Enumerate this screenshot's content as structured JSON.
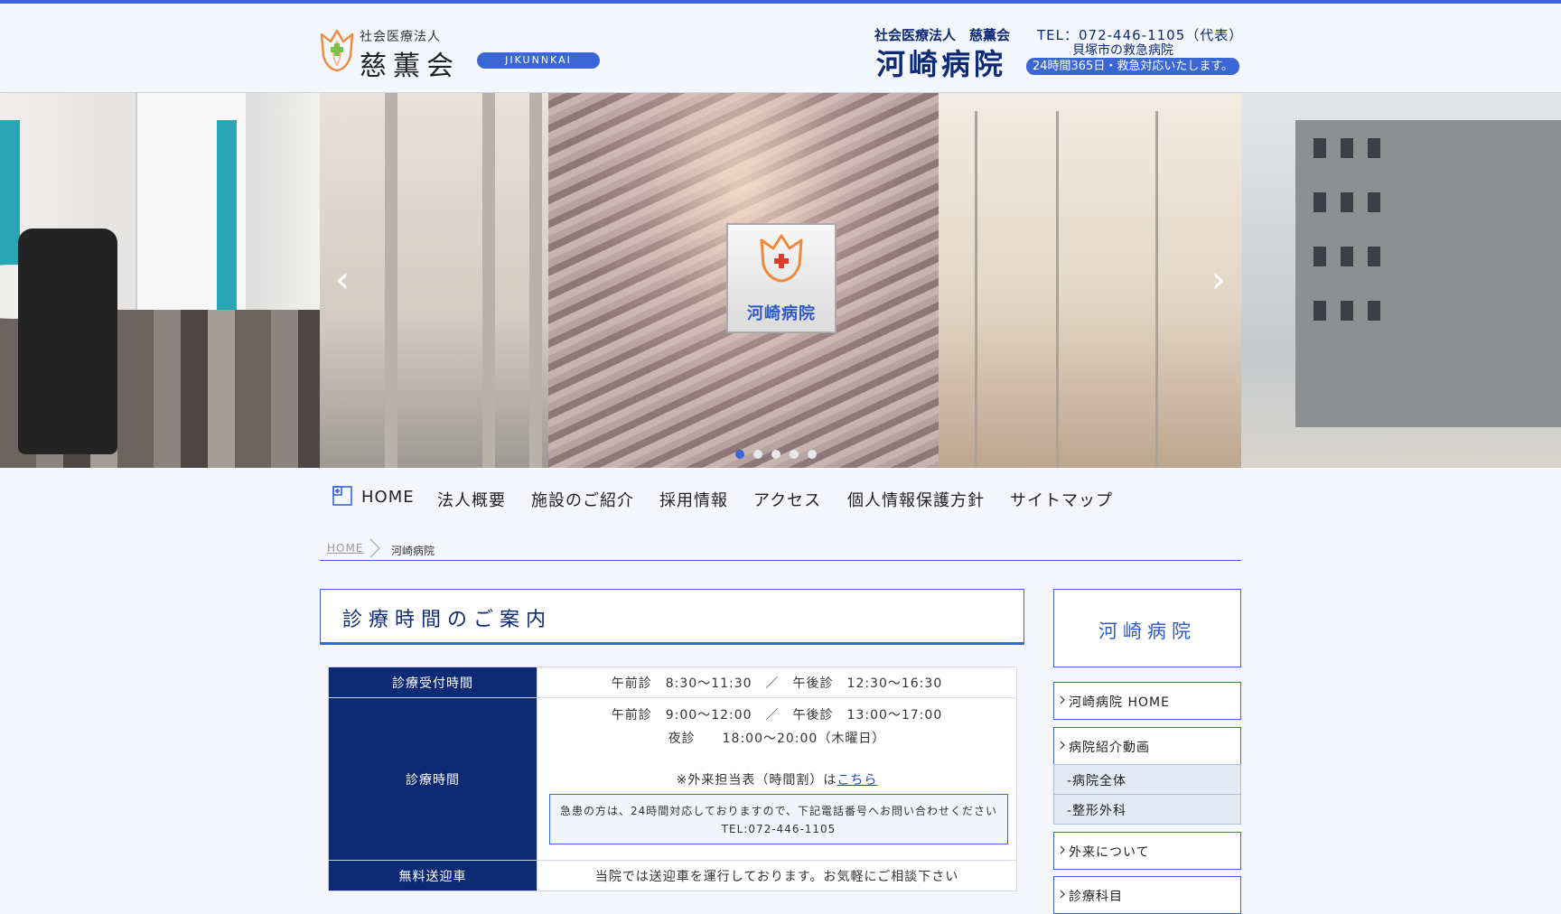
{
  "header": {
    "corp_type": "社会医療法人",
    "corp_name": "慈薫会",
    "corp_romaji": "JIKUNNKAI",
    "hospital_corp_line": "社会医療法人　慈薫会",
    "hospital_name": "河崎病院",
    "tel": "TEL：072-446-1105（代表）",
    "emergency_line": "貝塚市の救急病院",
    "badge_247": "24時間365日・救急対応いたします。"
  },
  "slider": {
    "sign_text": "河崎病院",
    "prev_glyph": "‹",
    "next_glyph": "›",
    "dot_count": 5,
    "active_dot": 1
  },
  "nav": {
    "items": [
      "HOME",
      "法人概要",
      "施設のご紹介",
      "採用情報",
      "アクセス",
      "個人情報保護方針",
      "サイトマップ"
    ]
  },
  "breadcrumb": {
    "home": "HOME",
    "current": "河崎病院"
  },
  "main": {
    "section_title": "診療時間のご案内",
    "rows": [
      {
        "header": "診療受付時間",
        "value": "午前診　8:30～11:30　／　午後診　12:30～16:30"
      },
      {
        "header": "診療時間",
        "line1": "午前診　9:00～12:00　／　午後診　13:00～17:00",
        "line2": "夜診　　18:00～20:00（木曜日）",
        "note_prefix": "※外来担当表（時間割）は",
        "note_link": "こちら",
        "emergency_note": "急患の方は、24時間対応しておりますので、下記電話番号へお問い合わせください",
        "emergency_tel": "TEL:072-446-1105"
      },
      {
        "header": "無料送迎車",
        "value": "当院では送迎車を運行しております。お気軽にご相談下さい"
      }
    ]
  },
  "sidebar": {
    "title": "河崎病院",
    "items": [
      {
        "label": "河崎病院 HOME"
      },
      {
        "label": "病院紹介動画"
      },
      {
        "label": "外来について"
      },
      {
        "label": "診療科目"
      }
    ],
    "subitems": [
      {
        "label": "‐病院全体"
      },
      {
        "label": "‐整形外科"
      }
    ]
  },
  "colors": {
    "accent": "#3a66d6",
    "navy": "#0d2a75",
    "page_bg": "#f5f7fc",
    "logo_orange": "#f08a3c",
    "logo_green": "#7cc04a"
  }
}
